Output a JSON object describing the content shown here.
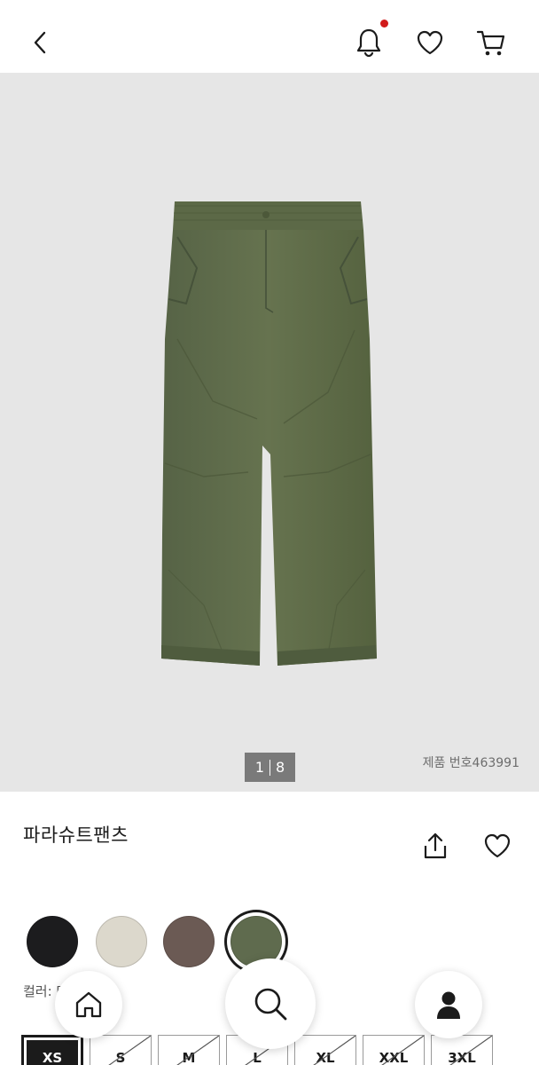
{
  "header": {
    "back_icon": "chevron-left-icon",
    "notification_icon": "bell-icon",
    "wishlist_icon": "heart-icon",
    "cart_icon": "cart-icon",
    "notification_dot_color": "#d11a1a"
  },
  "gallery": {
    "current_page": "1",
    "total_pages": "8",
    "product_number": "제품 번호463991"
  },
  "product": {
    "name": "파라슈트팬츠",
    "share_icon": "share-icon",
    "wishlist_icon": "heart-icon"
  },
  "colors": {
    "swatches": [
      {
        "color": "#1c1c1e",
        "selected": false
      },
      {
        "color": "#dcd8cc",
        "selected": false
      },
      {
        "color": "#6b5a54",
        "selected": false
      },
      {
        "color": "#5f6b4e",
        "selected": true
      }
    ],
    "label": "컬러: 다크 그린"
  },
  "sizes": {
    "options": [
      {
        "label": "XS",
        "selected": true,
        "available": true
      },
      {
        "label": "S",
        "selected": false,
        "available": false
      },
      {
        "label": "M",
        "selected": false,
        "available": false
      },
      {
        "label": "L",
        "selected": false,
        "available": false
      },
      {
        "label": "XL",
        "selected": false,
        "available": false
      },
      {
        "label": "XXL",
        "selected": false,
        "available": false
      },
      {
        "label": "3XL",
        "selected": false,
        "available": false
      }
    ]
  },
  "bottom_nav": {
    "home_icon": "home-icon",
    "search_icon": "search-icon",
    "account_icon": "user-icon"
  }
}
